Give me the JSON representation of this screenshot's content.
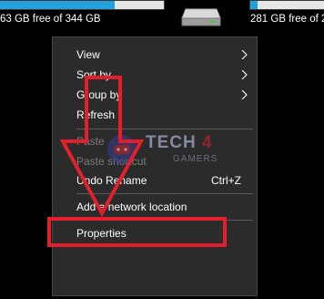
{
  "drives": [
    {
      "free_text": "63 GB free of 344 GB",
      "used_fraction": 0.71,
      "icon": "hard-drive-icon"
    },
    {
      "free_text": "281 GB free of 292 GB",
      "used_fraction": 0.12,
      "icon": "hard-drive-icon"
    }
  ],
  "context_menu": {
    "items": [
      {
        "label": "View",
        "has_submenu": true,
        "enabled": true
      },
      {
        "label": "Sort by",
        "has_submenu": true,
        "enabled": true
      },
      {
        "label": "Group by",
        "has_submenu": true,
        "enabled": true
      },
      {
        "label": "Refresh",
        "has_submenu": false,
        "enabled": true
      },
      {
        "label": "Paste",
        "has_submenu": false,
        "enabled": false
      },
      {
        "label": "Paste shortcut",
        "has_submenu": false,
        "enabled": false
      },
      {
        "label": "Undo Rename",
        "shortcut": "Ctrl+Z",
        "has_submenu": false,
        "enabled": true
      },
      {
        "label": "Add a network location",
        "has_submenu": false,
        "enabled": true
      },
      {
        "label": "Properties",
        "has_submenu": false,
        "enabled": true,
        "highlighted": true
      }
    ]
  },
  "watermark": {
    "brand": "TECH",
    "brand_number": "4",
    "sub": "GAMERS"
  },
  "colors": {
    "annotation_red": "#e41f2d",
    "menu_bg": "#2b2b2b",
    "drive_bar_used": "#26a0da",
    "disabled_text": "#7a7a7a"
  }
}
